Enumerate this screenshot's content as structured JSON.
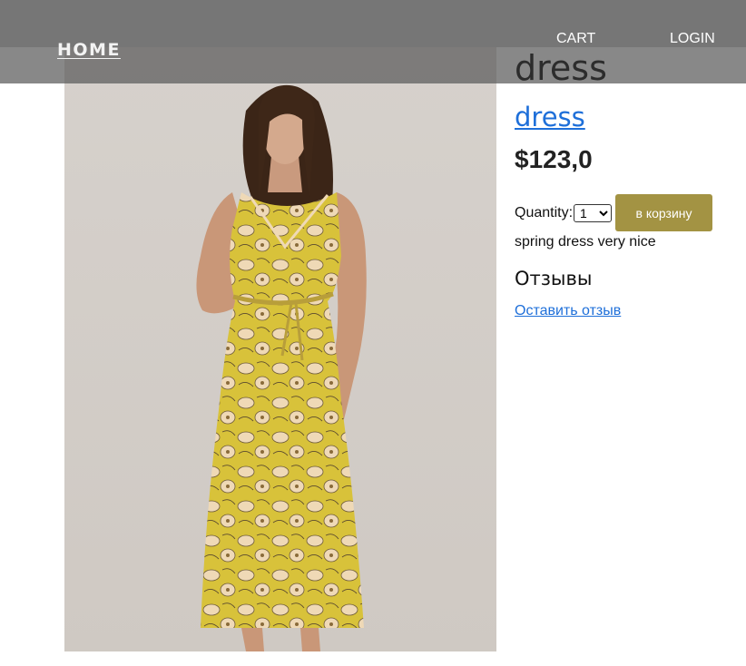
{
  "header": {
    "home_label": "HOME",
    "cart_label": "CART",
    "login_label": "LOGIN"
  },
  "product": {
    "title": "dress",
    "title_link": "dress",
    "price": "$123,0",
    "quantity_label": "Quantity:",
    "quantity_value": "1",
    "quantity_options": [
      "1"
    ],
    "add_to_cart_label": "в корзину",
    "description": "spring dress very nice"
  },
  "reviews": {
    "heading": "Отзывы",
    "leave_review_link": "Оставить отзыв"
  },
  "colors": {
    "header_overlay": "#5a5a5a",
    "link": "#1e6fd9",
    "cart_button": "#a39343",
    "dress": "#d8c23a",
    "background": "#ffffff"
  }
}
